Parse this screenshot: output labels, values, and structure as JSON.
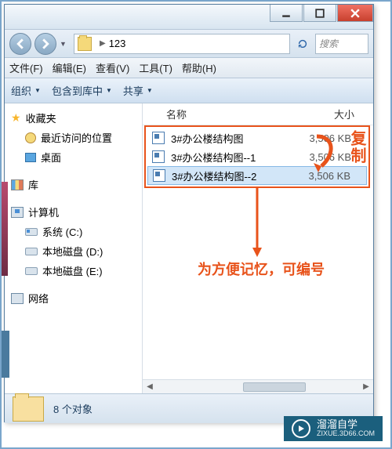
{
  "window": {
    "title": "123",
    "path_segments": [
      "123"
    ]
  },
  "search": {
    "placeholder": "搜索"
  },
  "menubar": {
    "file": "文件(F)",
    "edit": "编辑(E)",
    "view": "查看(V)",
    "tools": "工具(T)",
    "help": "帮助(H)"
  },
  "toolbar": {
    "organize": "组织",
    "include": "包含到库中",
    "share": "共享"
  },
  "nav": {
    "favorites": "收藏夹",
    "recent": "最近访问的位置",
    "desktop": "桌面",
    "libraries": "库",
    "computer": "计算机",
    "system_c": "系统 (C:)",
    "disk_d": "本地磁盘 (D:)",
    "disk_e": "本地磁盘 (E:)",
    "network": "网络"
  },
  "columns": {
    "name": "名称",
    "size": "大小"
  },
  "files": [
    {
      "name": "3#办公楼结构图",
      "size": "3,506 KB"
    },
    {
      "name": "3#办公楼结构图--1",
      "size": "3,506 KB"
    },
    {
      "name": "3#办公楼结构图--2",
      "size": "3,506 KB"
    }
  ],
  "annotations": {
    "copy_badge": "复制",
    "tip": "为方便记忆，可编号"
  },
  "status": {
    "count": "8 个对象"
  },
  "watermark": {
    "brand": "溜溜自学",
    "sub": "ZIXUE.3D66.COM"
  },
  "colors": {
    "accent": "#e8531b",
    "brand": "#1b5f7d"
  }
}
